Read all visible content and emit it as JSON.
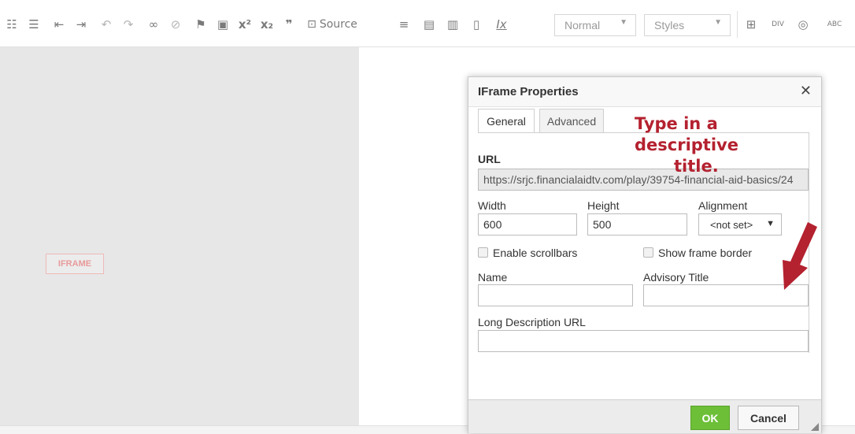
{
  "toolbar": {
    "icons": {
      "bulleted_list": "☷",
      "numbered_list": "☰",
      "decrease_indent": "⇤",
      "increase_indent": "⇥",
      "undo": "↶",
      "redo": "↷",
      "link": "∞",
      "unlink": "⊘",
      "anchor": "⚑",
      "image": "▣",
      "superscript": "x²",
      "subscript": "x₂",
      "blockquote": "❞",
      "source": "⊡",
      "horizontal_rule": "≡",
      "paste": "▤",
      "paste_text": "▥",
      "paste_word": "▯",
      "remove_format": "Ix",
      "table": "⊞",
      "div": "DIV",
      "iframe": "◎",
      "spellcheck": "ABC"
    },
    "source_label": "Source",
    "format_combo": "Normal",
    "styles_combo": "Styles"
  },
  "editor": {
    "placeholder_label": "IFRAME"
  },
  "dialog": {
    "title": "IFrame Properties",
    "close_glyph": "✕",
    "tabs": [
      "General",
      "Advanced"
    ],
    "url_label": "URL",
    "url_value": "https://srjc.financialaidtv.com/play/39754-financial-aid-basics/24",
    "width_label": "Width",
    "width_value": "600",
    "height_label": "Height",
    "height_value": "500",
    "alignment_label": "Alignment",
    "alignment_value": "<not set>",
    "scrollbars_label": "Enable scrollbars",
    "frameborder_label": "Show frame border",
    "name_label": "Name",
    "name_value": "",
    "advisory_label": "Advisory Title",
    "advisory_value": "",
    "longdesc_label": "Long Description URL",
    "longdesc_value": "",
    "ok_label": "OK",
    "cancel_label": "Cancel"
  },
  "annotation": {
    "line1": "Type in a descriptive",
    "line2": "title.",
    "color": "#b4212f"
  }
}
